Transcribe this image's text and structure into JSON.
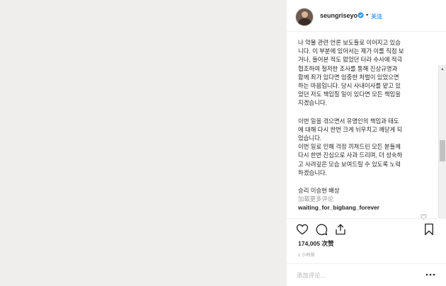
{
  "header": {
    "username": "seungriseyo",
    "separator": "•",
    "follow_label": "关注"
  },
  "caption": {
    "paragraph1": [
      "나 약물 관련 언론 보도들로 이어지고 있습",
      "니다. 이 부분에 있어서는 제가 이를 직접 보",
      "거나, 들어본 적도 없었던 터라 수사에 적극",
      "협조하여 철저한 조사를 통해 진상규명과",
      "함께 죄가 있다면 엄중한 처벌이 있었으면",
      "하는 마음입니다. 당시 사내이사를 맡고 있",
      "었던 저도 책임질 일이 있다면 모든 책임을",
      "지겠습니다."
    ],
    "paragraph2": [
      "이번 일을 겪으면서 유명인의 책임과 태도",
      "에 대해 다시 한번 크게 뉘우치고 깨닫게 되",
      "었습니다.",
      "이번 일로 인해 걱정 끼쳐드린 모든 분들께",
      "다시 한번 진심으로 사과 드리며, 더 성숙하",
      "고 사려깊은 모습 보여드릴 수 있도록 노력",
      "하겠습니다."
    ],
    "signature": "승리 이승현 배상",
    "load_more": "加载更多评论",
    "comment_user": "waiting_for_bigbang_forever"
  },
  "actions": {
    "likes": "174,005 次赞",
    "time": "1 小时前"
  },
  "comment_box": {
    "placeholder": "添加评论..."
  },
  "colors": {
    "accent": "#3897f0",
    "photo_bg": "#efeeec",
    "text": "#262626",
    "muted": "#999999"
  }
}
